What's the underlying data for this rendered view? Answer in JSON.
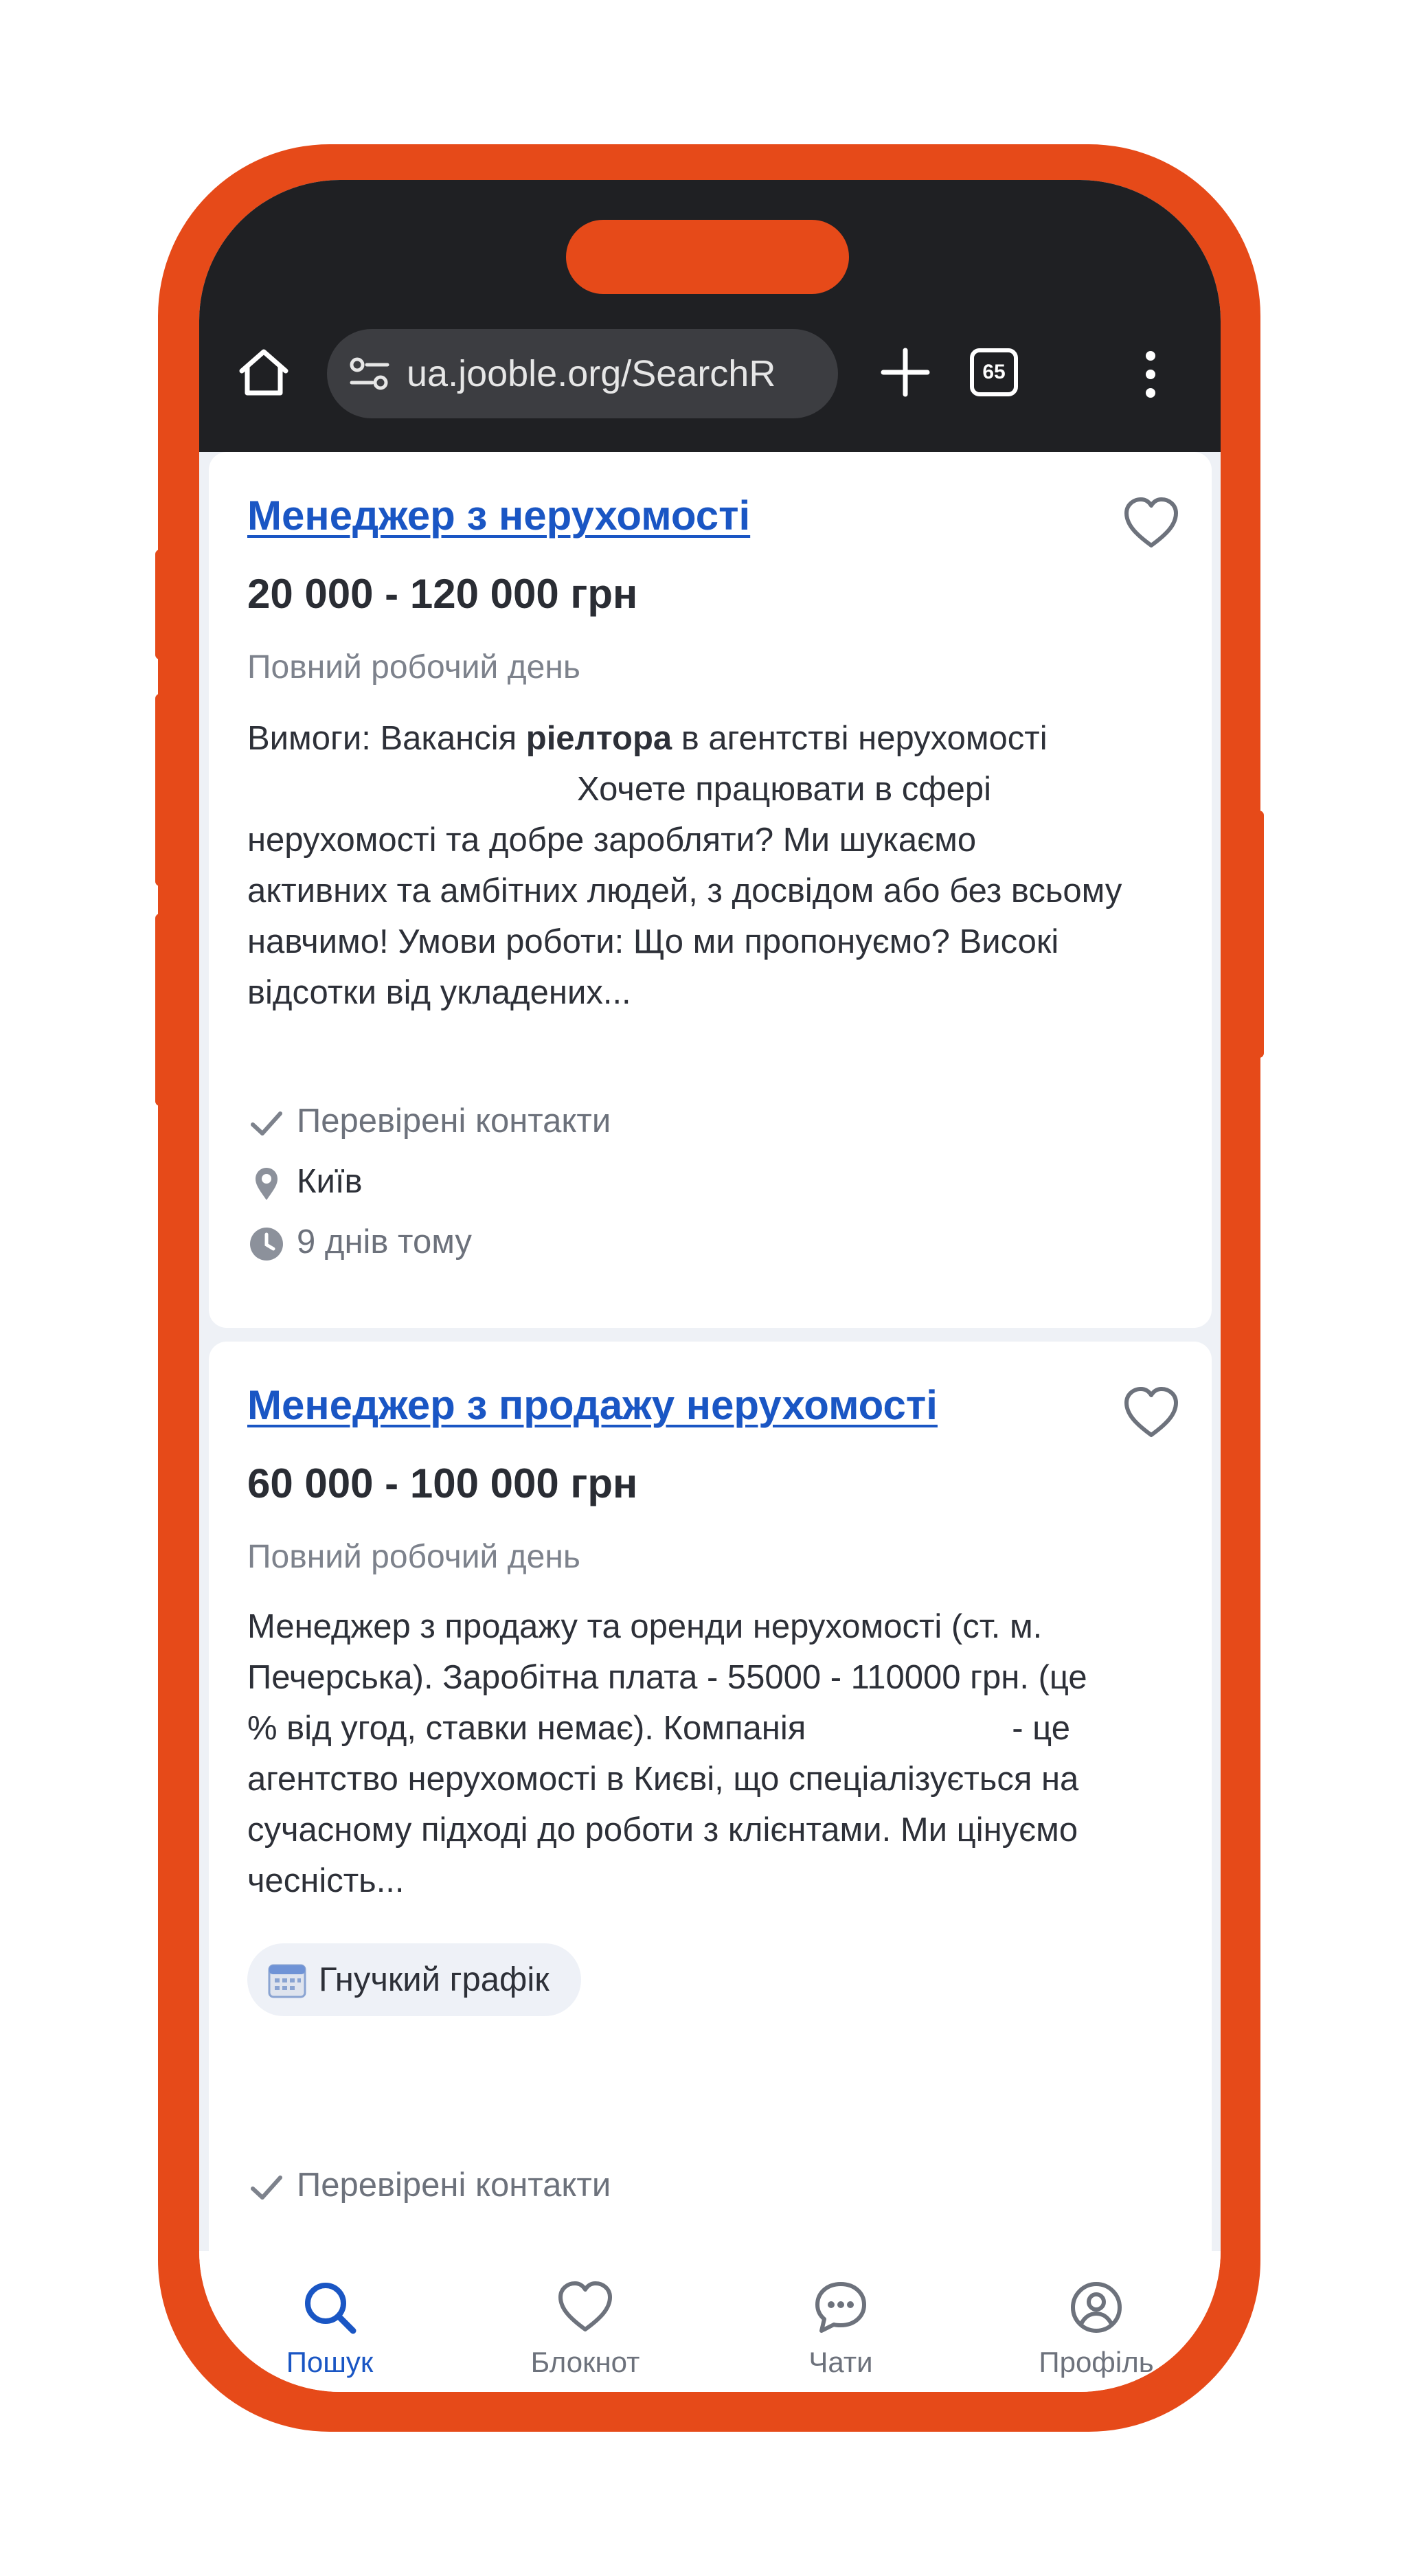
{
  "browser": {
    "url": "ua.jooble.org/SearchR",
    "tab_count": "65"
  },
  "jobs": [
    {
      "title": "Менеджер з нерухомості",
      "salary": "20 000 - 120 000 грн",
      "schedule": "Повний робочий день",
      "description": {
        "line1_prefix": "Вимоги: Вакансія ",
        "line1_bold": "ріелтора",
        "line1_suffix": " в агентстві нерухомості",
        "line2": "Хочете працювати в сфері",
        "line3": "нерухомості та добре заробляти? Ми шукаємо",
        "line4": "активних та амбітних людей, з досвідом або без всьому",
        "line5": "навчимо! Умови роботи: Що ми пропонуємо? Високі",
        "line6": "відсотки від укладених..."
      },
      "verified": "Перевірені контакти",
      "location": "Київ",
      "posted": "9 днів тому"
    },
    {
      "title": "Менеджер з продажу нерухомості",
      "salary": "60 000 - 100 000 грн",
      "schedule": "Повний робочий день",
      "description": {
        "line1": "Менеджер з продажу та оренди нерухомості (ст. м.",
        "line2": "Печерська). Заробітна плата - 55000 - 110000 грн. (це",
        "line3_prefix": "% від угод, ставки немає). Компанія",
        "line3_suffix": "- це",
        "line4": "агентство нерухомості в Києві, що спеціалізується на",
        "line5": "сучасному підході до роботи з клієнтами. Ми цінуємо",
        "line6": "чесність..."
      },
      "tag": "Гнучкий графік",
      "verified": "Перевірені контакти"
    }
  ],
  "bottom_nav": [
    {
      "label": "Пошук",
      "icon": "search-icon",
      "active": true
    },
    {
      "label": "Блокнот",
      "icon": "heart-icon",
      "active": false
    },
    {
      "label": "Чати",
      "icon": "chat-icon",
      "active": false
    },
    {
      "label": "Профіль",
      "icon": "profile-icon",
      "active": false
    }
  ],
  "colors": {
    "frame": "#e64a19",
    "link": "#1a56c4",
    "topbar": "#1f2023"
  }
}
